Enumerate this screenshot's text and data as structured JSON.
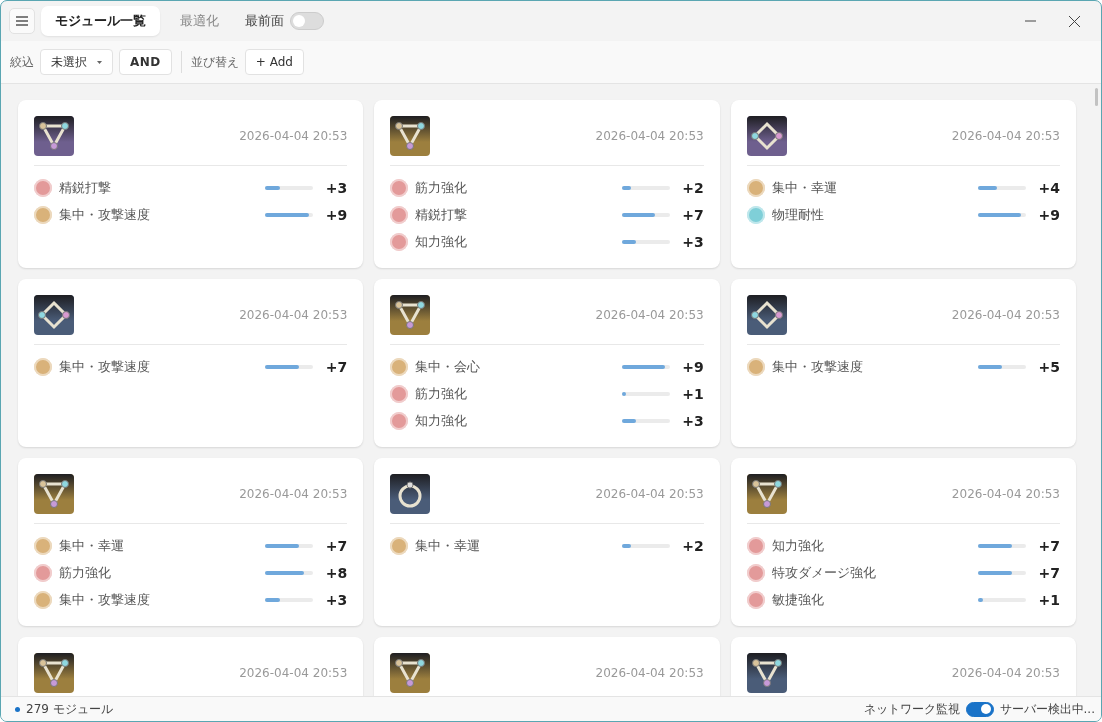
{
  "tabs": [
    {
      "label": "モジュール一覧",
      "selected": true
    },
    {
      "label": "最適化",
      "selected": false
    }
  ],
  "pin_toggle": {
    "label": "最前面",
    "on": false
  },
  "toolbar": {
    "filter_label": "絞込",
    "filter_value": "未選択",
    "and_button": "AND",
    "sort_label": "並び替え",
    "add_button": "+ Add"
  },
  "cards": [
    {
      "kind": "triangle",
      "color": "#6e5f8e",
      "date": "2026-04-04 20:53",
      "stats": [
        {
          "name": "精鋭打撃",
          "color": "#e39a9a",
          "level": 0.3,
          "value": "+3"
        },
        {
          "name": "集中・攻撃速度",
          "color": "#d9b27a",
          "level": 0.9,
          "value": "+9"
        }
      ]
    },
    {
      "kind": "triangle",
      "color": "#9c7f3e",
      "date": "2026-04-04 20:53",
      "stats": [
        {
          "name": "筋力強化",
          "color": "#e39a9a",
          "level": 0.2,
          "value": "+2"
        },
        {
          "name": "精鋭打撃",
          "color": "#e39a9a",
          "level": 0.7,
          "value": "+7"
        },
        {
          "name": "知力強化",
          "color": "#e39a9a",
          "level": 0.3,
          "value": "+3"
        }
      ]
    },
    {
      "kind": "diamond",
      "color": "#6e5f8e",
      "date": "2026-04-04 20:53",
      "stats": [
        {
          "name": "集中・幸運",
          "color": "#d9b27a",
          "level": 0.4,
          "value": "+4"
        },
        {
          "name": "物理耐性",
          "color": "#7fcfd8",
          "level": 0.9,
          "value": "+9"
        }
      ]
    },
    {
      "kind": "diamond",
      "color": "#4a5c78",
      "date": "2026-04-04 20:53",
      "stats": [
        {
          "name": "集中・攻撃速度",
          "color": "#d9b27a",
          "level": 0.7,
          "value": "+7"
        }
      ]
    },
    {
      "kind": "triangle",
      "color": "#9c7f3e",
      "date": "2026-04-04 20:53",
      "stats": [
        {
          "name": "集中・会心",
          "color": "#d9b27a",
          "level": 0.9,
          "value": "+9"
        },
        {
          "name": "筋力強化",
          "color": "#e39a9a",
          "level": 0.1,
          "value": "+1"
        },
        {
          "name": "知力強化",
          "color": "#e39a9a",
          "level": 0.3,
          "value": "+3"
        }
      ]
    },
    {
      "kind": "diamond",
      "color": "#4a5c78",
      "date": "2026-04-04 20:53",
      "stats": [
        {
          "name": "集中・攻撃速度",
          "color": "#d9b27a",
          "level": 0.5,
          "value": "+5"
        }
      ]
    },
    {
      "kind": "triangle",
      "color": "#9c7f3e",
      "date": "2026-04-04 20:53",
      "stats": [
        {
          "name": "集中・幸運",
          "color": "#d9b27a",
          "level": 0.7,
          "value": "+7"
        },
        {
          "name": "筋力強化",
          "color": "#e39a9a",
          "level": 0.8,
          "value": "+8"
        },
        {
          "name": "集中・攻撃速度",
          "color": "#d9b27a",
          "level": 0.3,
          "value": "+3"
        }
      ]
    },
    {
      "kind": "ring",
      "color": "#4a5c78",
      "date": "2026-04-04 20:53",
      "stats": [
        {
          "name": "集中・幸運",
          "color": "#d9b27a",
          "level": 0.2,
          "value": "+2"
        }
      ]
    },
    {
      "kind": "triangle",
      "color": "#9c7f3e",
      "date": "2026-04-04 20:53",
      "stats": [
        {
          "name": "知力強化",
          "color": "#e39a9a",
          "level": 0.7,
          "value": "+7"
        },
        {
          "name": "特攻ダメージ強化",
          "color": "#e39a9a",
          "level": 0.7,
          "value": "+7"
        },
        {
          "name": "敏捷強化",
          "color": "#e39a9a",
          "level": 0.1,
          "value": "+1"
        }
      ]
    },
    {
      "kind": "triangle",
      "color": "#9c7f3e",
      "date": "2026-04-04 20:53"
    },
    {
      "kind": "triangle",
      "color": "#9c7f3e",
      "date": "2026-04-04 20:53"
    },
    {
      "kind": "triangle",
      "color": "#4a5c78",
      "date": "2026-04-04 20:53"
    }
  ],
  "status_bar": {
    "count": "279 モジュール",
    "network_label": "ネットワーク監視",
    "network_on": true,
    "server_status": "サーバー検出中..."
  }
}
